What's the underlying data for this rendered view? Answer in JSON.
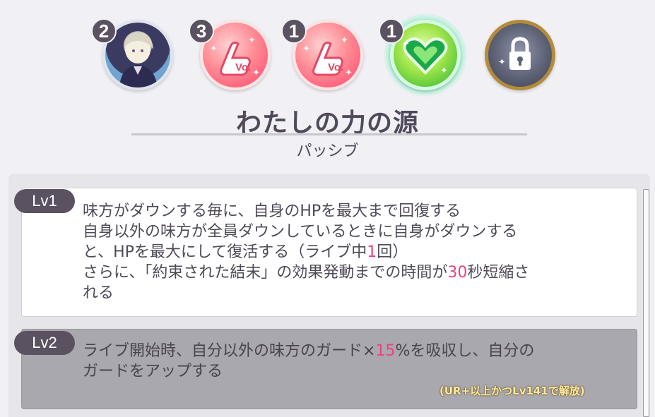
{
  "icons": [
    {
      "name": "character-portrait",
      "count": "2"
    },
    {
      "name": "vocal-boost",
      "count": "3",
      "label": "Vo."
    },
    {
      "name": "vocal-boost",
      "count": "1",
      "label": "Vo."
    },
    {
      "name": "heart",
      "count": "1"
    },
    {
      "name": "locked-portrait"
    }
  ],
  "skill": {
    "title": "わたしの力の源",
    "type": "パッシブ"
  },
  "levels": [
    {
      "tag": "Lv1",
      "line1": "味方がダウンする毎に、自身のHPを最大まで回復する",
      "line2": "自身以外の味方が全員ダウンしているときに自身がダウンする",
      "line3_pre": "と、HPを最大にして復活する（ライブ中",
      "line3_num": "1",
      "line3_post": "回）",
      "line4_pre": "さらに、「約束された結末」の効果発動までの時間が",
      "line4_num": "30",
      "line4_post": "秒短縮さ",
      "line5": "れる"
    },
    {
      "tag": "Lv2",
      "line1_pre": "ライブ開始時、自分以外の味方のガード×",
      "line1_num": "15",
      "line1_post": "%を吸収し、自分の",
      "line2": "ガードをアップする",
      "unlock": "(UR+以上かつLv141で解放)"
    }
  ],
  "colors": {
    "highlight": "#ee3f86",
    "badge": "#5a5260"
  }
}
